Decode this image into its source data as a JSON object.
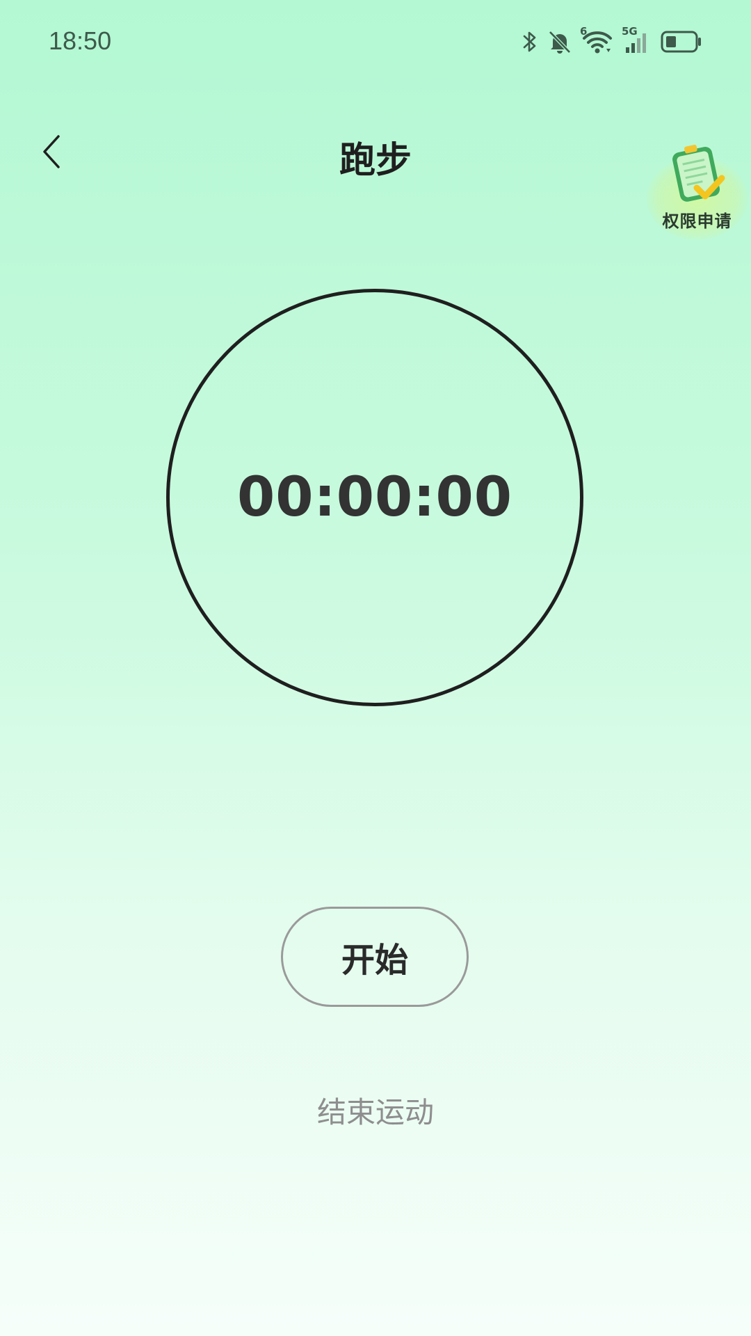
{
  "status_bar": {
    "time": "18:50",
    "icons": [
      "bluetooth-icon",
      "bell-muted-icon",
      "wifi-icon",
      "cellular-5g-icon",
      "battery-icon"
    ],
    "wifi_badge": "6",
    "network_badge": "5G"
  },
  "header": {
    "title": "跑步",
    "back_icon": "chevron-left-icon"
  },
  "permission": {
    "label": "权限申请",
    "icon": "clipboard-check-icon"
  },
  "timer": {
    "value": "00:00:00"
  },
  "controls": {
    "start_label": "开始",
    "end_label": "结束运动"
  },
  "colors": {
    "background_top": "#b3f8d3",
    "background_bottom": "#f6fefa",
    "ring": "#1f1f1f",
    "muted_text": "#8e8e8e"
  }
}
